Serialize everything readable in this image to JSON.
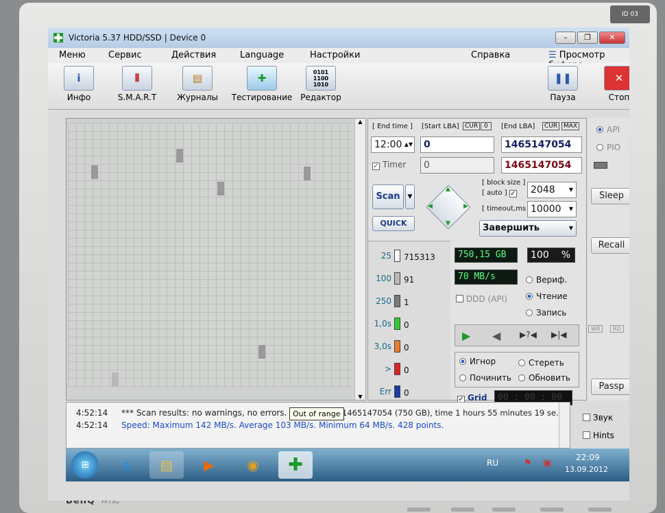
{
  "window": {
    "title": "Victoria 5.37 HDD/SSD | Device 0"
  },
  "menu": [
    "Меню",
    "Сервис",
    "Действия",
    "Language",
    "Настройки",
    "Справка",
    "Просмотр буфера"
  ],
  "toolbar": {
    "info": "Инфо",
    "smart": "S.M.A.R.T",
    "journals": "Журналы",
    "testing": "Тестирование",
    "editor": "Редактор",
    "pause": "Пауза",
    "stop": "Стоп"
  },
  "scan": {
    "end_time_label": "[ End time ]",
    "start_lba_label": "[Start LBA]",
    "cur_label": "CUR",
    "zero_btn": "0",
    "end_lba_label": "[End LBA]",
    "cur2_label": "CUR",
    "max_label": "MAX",
    "end_time": "12:00",
    "start_lba": "0",
    "end_lba": "1465147054",
    "timer_label": "Timer",
    "timer_value": "0",
    "end_lba2": "1465147054",
    "scan_btn": "Scan",
    "quick_btn": "QUICK",
    "block_size_label": "[ block size ]",
    "auto_label": "[ auto ]",
    "block_size": "2048",
    "timeout_label": "[ timeout,ms ]",
    "timeout": "10000",
    "action": "Завершить"
  },
  "stats": [
    {
      "label": "25",
      "count": "715313",
      "color": "#ffffff"
    },
    {
      "label": "100",
      "count": "91",
      "color": "#b8b8b8"
    },
    {
      "label": "250",
      "count": "1",
      "color": "#7a7a7a"
    },
    {
      "label": "1,0s",
      "count": "0",
      "color": "#33cc33"
    },
    {
      "label": "3,0s",
      "count": "0",
      "color": "#e87d2a"
    },
    {
      "label": ">",
      "count": "0",
      "color": "#dd2222"
    },
    {
      "label": "Err",
      "count": "0",
      "color": "#1a3aa8"
    }
  ],
  "readouts": {
    "size": "750,15 GB",
    "percent": "100",
    "percent_unit": "%",
    "speed": "70 MB/s",
    "verify": "Вериф.",
    "read": "Чтение",
    "write": "Запись",
    "ddd": "DDD (API)",
    "ignore": "Игнор",
    "erase": "Стереть",
    "repair": "Починить",
    "refresh": "Обновить",
    "grid": "Grid",
    "elapsed": "00 : 00 : 00"
  },
  "side": {
    "api": "API",
    "pio": "PIO",
    "sleep": "Sleep",
    "recall": "Recall",
    "wr": "WR",
    "rd": "RD",
    "passp": "Passp",
    "sound": "Звук",
    "hints": "Hints"
  },
  "log": [
    {
      "time": "4:52:14",
      "text": "*** Scan results: no warnings, no errors.",
      "tail": "1465147054 (750 GB), time 1 hours 55 minutes 19 se."
    },
    {
      "time": "4:52:14",
      "text": "Speed: Maximum 142 MB/s. Average 103 MB/s. Minimum 64 MB/s. 428 points."
    }
  ],
  "tooltip": "Out of range",
  "tray": {
    "lang": "RU",
    "time": "22:09",
    "date": "13.09.2012"
  },
  "monitor": {
    "brand": "BenQ",
    "model": "FP73G"
  }
}
